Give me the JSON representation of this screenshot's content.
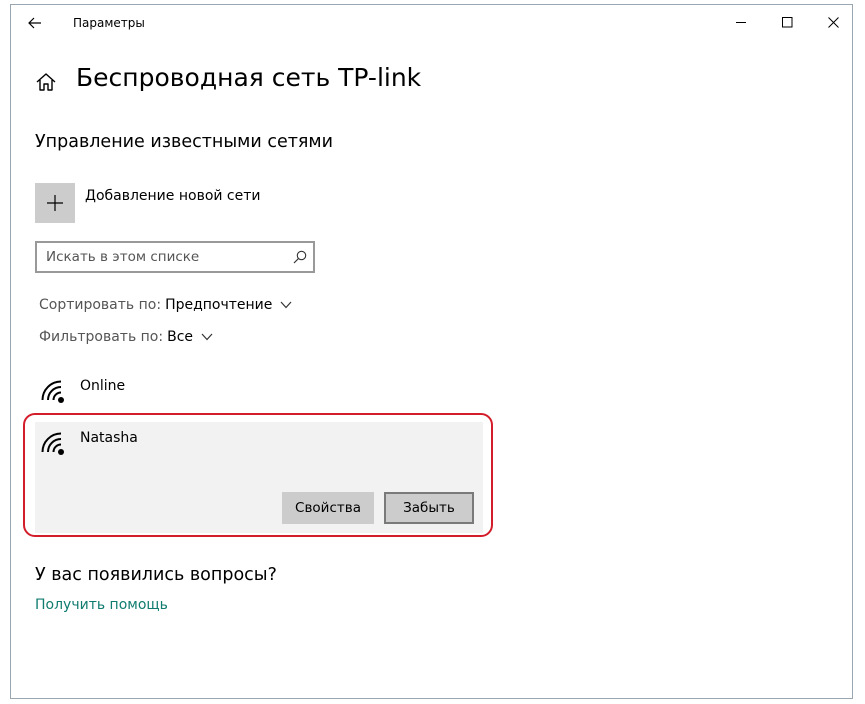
{
  "window": {
    "title": "Параметры"
  },
  "page": {
    "title": "Беспроводная сеть TP-link"
  },
  "known_networks": {
    "section_title": "Управление известными сетями",
    "add_network_label": "Добавление новой сети",
    "search_placeholder": "Искать в этом списке",
    "sort_label": "Сортировать по:",
    "sort_value": "Предпочтение",
    "filter_label": "Фильтровать по:",
    "filter_value": "Все",
    "networks": [
      {
        "name": "Online"
      },
      {
        "name": "Natasha"
      }
    ],
    "properties_button": "Свойства",
    "forget_button": "Забыть"
  },
  "help": {
    "title": "У вас появились вопросы?",
    "link": "Получить помощь"
  },
  "colors": {
    "accent_link": "#107c6f",
    "selection_outline": "#d31d2a",
    "button_bg": "#cccccc",
    "selected_row_bg": "#f2f2f2"
  },
  "icons": [
    "back-arrow-icon",
    "minimize-icon",
    "maximize-icon",
    "close-icon",
    "home-icon",
    "plus-icon",
    "search-icon",
    "chevron-down-icon",
    "wifi-icon"
  ]
}
